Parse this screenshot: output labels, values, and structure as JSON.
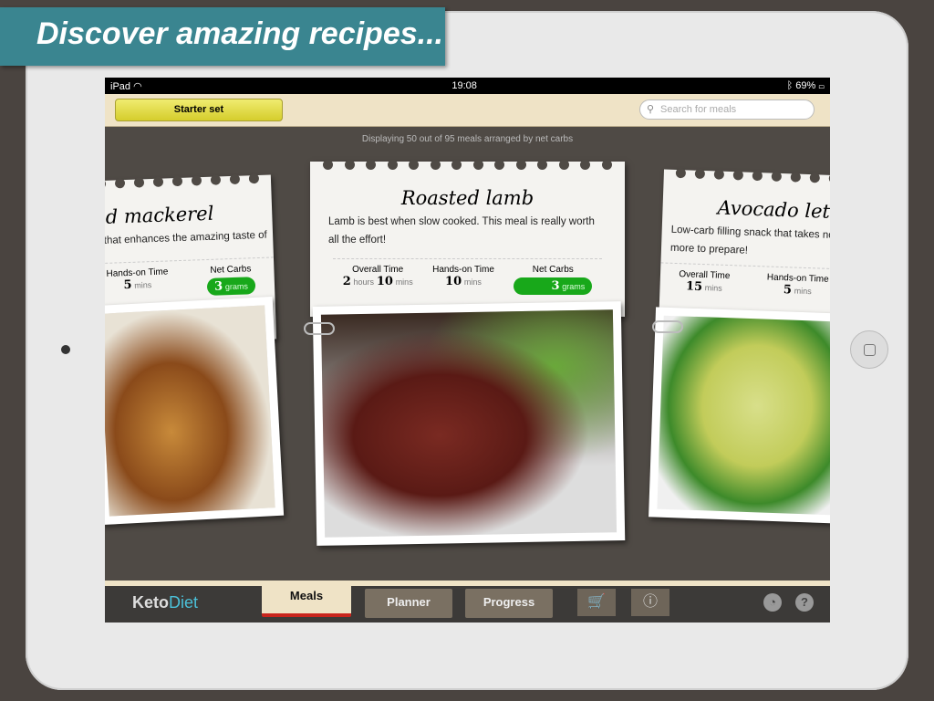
{
  "banner": "Discover amazing recipes...",
  "status": {
    "device": "iPad",
    "time": "19:08",
    "battery": "69%"
  },
  "toolbar": {
    "starter_set": "Starter set",
    "search_placeholder": "Search for meals"
  },
  "info": "Displaying 50 out of 95 meals arranged by net carbs",
  "labels": {
    "overall": "Overall Time",
    "handson": "Hands-on Time",
    "carbs": "Net Carbs",
    "hours": "hours",
    "mins": "mins",
    "grams": "grams"
  },
  "cards": [
    {
      "title": "ed mackerel",
      "desc": "e that enhances the amazing taste of",
      "handson": "5",
      "carbs": "3"
    },
    {
      "title": "Roasted lamb",
      "desc": "Lamb is best when slow cooked. This meal is really worth all the effort!",
      "overall_h": "2",
      "overall_m": "10",
      "handson": "10",
      "carbs": "3"
    },
    {
      "title": "Avocado lettu",
      "desc": "Low-carb filling snack that takes no more to prepare!",
      "overall": "15",
      "handson": "5"
    }
  ],
  "nav": {
    "logo_a": "Keto",
    "logo_b": "Diet",
    "tabs": [
      "Meals",
      "Planner",
      "Progress"
    ],
    "active": "Meals",
    "icons": [
      "cart-icon",
      "info-icon",
      "settings-icon",
      "help-icon"
    ]
  }
}
